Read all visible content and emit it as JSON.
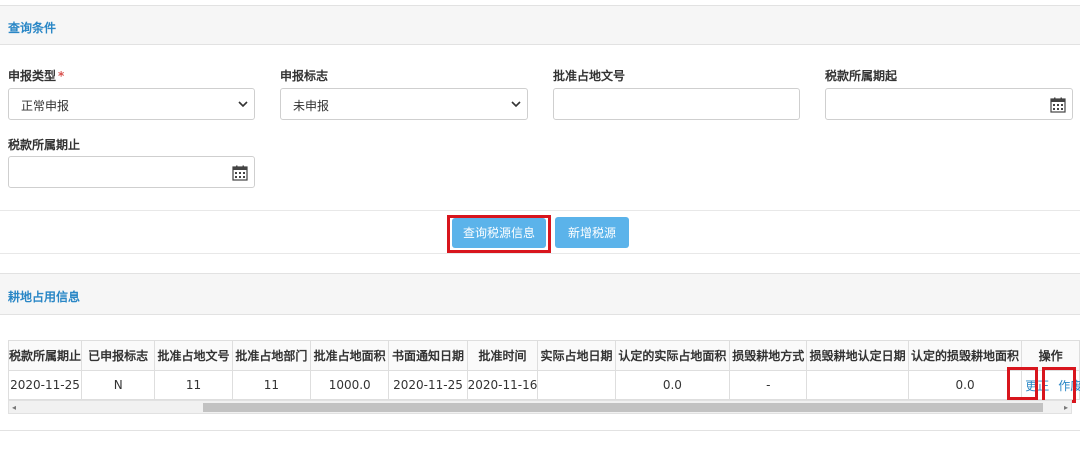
{
  "query_panel": {
    "title": "查询条件"
  },
  "filters": {
    "declare_type": {
      "label": "申报类型",
      "required_mark": "*",
      "value": "正常申报"
    },
    "declare_flag": {
      "label": "申报标志",
      "value": "未申报"
    },
    "approval_doc_no": {
      "label": "批准占地文号",
      "value": ""
    },
    "tax_period_start": {
      "label": "税款所属期起",
      "value": ""
    },
    "tax_period_end": {
      "label": "税款所属期止",
      "value": ""
    }
  },
  "buttons": {
    "query": "查询税源信息",
    "add": "新增税源"
  },
  "info_panel": {
    "title": "耕地占用信息"
  },
  "table": {
    "headers": [
      "税款所属期止",
      "已申报标志",
      "批准占地文号",
      "批准占地部门",
      "批准占地面积",
      "书面通知日期",
      "批准时间",
      "实际占地日期",
      "认定的实际占地面积",
      "损毁耕地方式",
      "损毁耕地认定日期",
      "认定的损毁耕地面积",
      "操作"
    ],
    "rows": [
      [
        "2020-11-25",
        "N",
        "11",
        "11",
        "1000.0",
        "2020-11-25",
        "2020-11-16",
        "",
        "0.0",
        "-",
        "",
        "0.0"
      ]
    ],
    "row_actions": [
      "更正",
      "作废"
    ]
  },
  "icons": {
    "select_arrow": "chevron-down-icon",
    "date_picker": "calendar-icon"
  },
  "colors": {
    "accent": "#2a87c6",
    "button": "#5bb3ea",
    "highlight": "#d8151d",
    "required": "#d9534f"
  }
}
